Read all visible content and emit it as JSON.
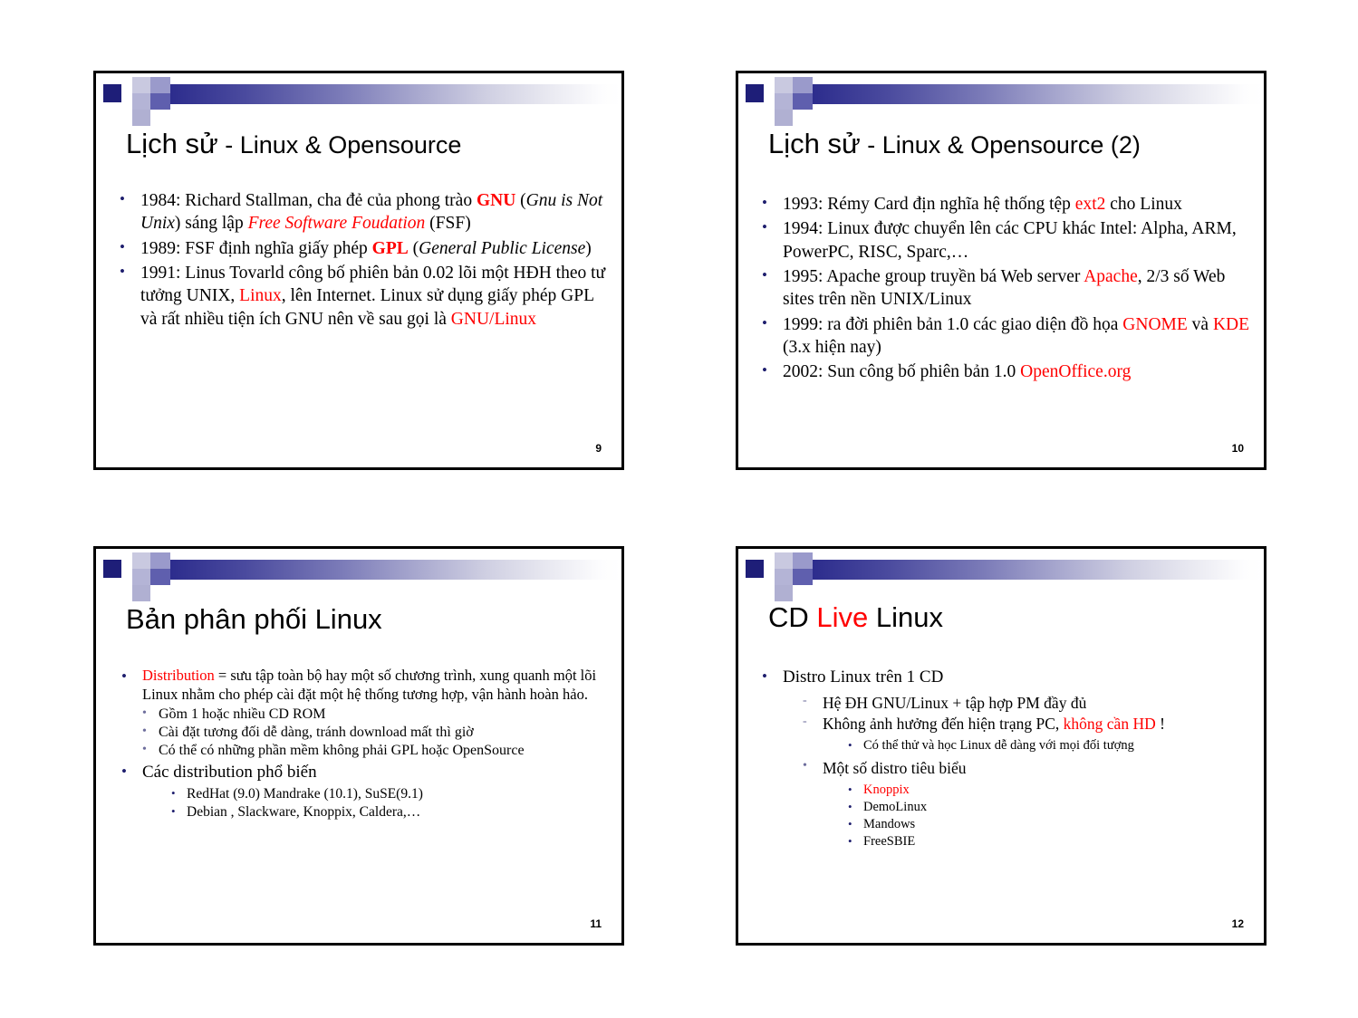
{
  "document": {
    "type": "presentation-handout",
    "slides_per_page": 4,
    "colors": {
      "accent_red": "#ff0000",
      "bullet_navy": "#1f1f6e",
      "band_dark": "#1e1e78",
      "frame_border": "#000000",
      "background": "#ffffff"
    }
  },
  "slides": [
    {
      "page_number": "9",
      "title": {
        "main": "Lịch sử",
        "separator": " - ",
        "rest": "Linux & Opensource"
      },
      "bullets": [
        {
          "level": 1,
          "runs": [
            {
              "text": "1984: Richard Stallman, cha đẻ của phong trào ",
              "style": "plain"
            },
            {
              "text": "GNU",
              "style": "bold-red"
            },
            {
              "text": " (",
              "style": "plain"
            },
            {
              "text": "Gnu is Not Unix",
              "style": "italic"
            },
            {
              "text": ") sáng lập ",
              "style": "plain"
            },
            {
              "text": "Free Software Foudation",
              "style": "italic-red"
            },
            {
              "text": " (FSF)",
              "style": "plain"
            }
          ]
        },
        {
          "level": 1,
          "runs": [
            {
              "text": "1989: FSF định nghĩa giấy phép ",
              "style": "plain"
            },
            {
              "text": "GPL",
              "style": "bold-red"
            },
            {
              "text": " (",
              "style": "plain"
            },
            {
              "text": "General Public License",
              "style": "italic"
            },
            {
              "text": ")",
              "style": "plain"
            }
          ]
        },
        {
          "level": 1,
          "runs": [
            {
              "text": "1991: Linus Tovarld công bố phiên bản 0.02 lõi một HĐH theo tư tưởng UNIX, ",
              "style": "plain"
            },
            {
              "text": "Linux",
              "style": "red"
            },
            {
              "text": ", lên Internet. Linux sử dụng giấy phép GPL và rất nhiều tiện ích GNU nên về sau gọi là ",
              "style": "plain"
            },
            {
              "text": "GNU/Linux",
              "style": "red"
            }
          ]
        }
      ]
    },
    {
      "page_number": "10",
      "title": {
        "main": "Lịch sử",
        "separator": " - ",
        "rest": "Linux & Opensource (2)"
      },
      "bullets": [
        {
          "level": 1,
          "runs": [
            {
              "text": "1993: Rémy Card địn nghĩa hệ thống tệp ",
              "style": "plain"
            },
            {
              "text": "ext2",
              "style": "red"
            },
            {
              "text": " cho Linux",
              "style": "plain"
            }
          ]
        },
        {
          "level": 1,
          "runs": [
            {
              "text": "1994: Linux được chuyển lên các CPU khác Intel: Alpha, ARM, PowerPC, RISC, Sparc,…",
              "style": "plain"
            }
          ]
        },
        {
          "level": 1,
          "runs": [
            {
              "text": "1995: Apache group truyền bá Web server ",
              "style": "plain"
            },
            {
              "text": "Apache",
              "style": "red"
            },
            {
              "text": ", 2/3 số Web sites trên nền UNIX/Linux",
              "style": "plain"
            }
          ]
        },
        {
          "level": 1,
          "runs": [
            {
              "text": "1999: ra đời phiên bản 1.0 các giao diện đồ họa ",
              "style": "plain"
            },
            {
              "text": "GNOME",
              "style": "red"
            },
            {
              "text": " và ",
              "style": "plain"
            },
            {
              "text": "KDE",
              "style": "red"
            },
            {
              "text": " (3.x hiện nay)",
              "style": "plain"
            }
          ]
        },
        {
          "level": 1,
          "runs": [
            {
              "text": "2002: Sun công bố phiên bản 1.0 ",
              "style": "plain"
            },
            {
              "text": "OpenOffice.org",
              "style": "red"
            }
          ]
        }
      ]
    },
    {
      "page_number": "11",
      "title": {
        "main": "Bản phân phối Linux",
        "separator": "",
        "rest": ""
      },
      "bullets": [
        {
          "level": 1,
          "runs": [
            {
              "text": "Distribution",
              "style": "red"
            },
            {
              "text": " = sưu tập toàn bộ hay một số chương trình, xung quanh một lõi Linux nhằm cho phép cài đặt một hệ thống tương hợp, vận hành hoàn hảo.",
              "style": "plain"
            }
          ]
        },
        {
          "level": 2,
          "runs": [
            {
              "text": "Gồm 1 hoặc nhiều CD ROM",
              "style": "plain"
            }
          ]
        },
        {
          "level": 2,
          "runs": [
            {
              "text": "Cài đặt tương đối dễ dàng, tránh download mất thì giờ",
              "style": "plain"
            }
          ]
        },
        {
          "level": 2,
          "runs": [
            {
              "text": "Có thể có những phần mềm không phải GPL hoặc OpenSource",
              "style": "plain"
            }
          ]
        },
        {
          "level": 1,
          "runs": [
            {
              "text": "Các distribution phổ biến",
              "style": "plain"
            }
          ]
        },
        {
          "level": 3,
          "runs": [
            {
              "text": "RedHat (9.0) Mandrake (10.1), SuSE(9.1)",
              "style": "plain"
            }
          ]
        },
        {
          "level": 3,
          "runs": [
            {
              "text": "Debian , Slackware, Knoppix, Caldera,…",
              "style": "plain"
            }
          ]
        }
      ]
    },
    {
      "page_number": "12",
      "title": {
        "main": "CD ",
        "separator": "Live",
        "rest": " Linux",
        "separator_red": true
      },
      "bullets": [
        {
          "level": 1,
          "runs": [
            {
              "text": "Distro Linux trên 1 CD",
              "style": "plain"
            }
          ]
        },
        {
          "level": 2,
          "marker": "dash",
          "runs": [
            {
              "text": "Hệ ĐH GNU/Linux + tập hợp PM đầy đủ",
              "style": "plain"
            }
          ]
        },
        {
          "level": 2,
          "marker": "dash",
          "runs": [
            {
              "text": "Không ảnh hưởng đến hiện trạng PC, ",
              "style": "plain"
            },
            {
              "text": "không cần HD",
              "style": "red"
            },
            {
              "text": " !",
              "style": "plain"
            }
          ]
        },
        {
          "level": 3,
          "runs": [
            {
              "text": "Có thể thử và học Linux dễ dàng với mọi đối tượng",
              "style": "plain"
            }
          ]
        },
        {
          "level": 2,
          "marker": "bullet",
          "runs": [
            {
              "text": "Một số distro tiêu biểu",
              "style": "plain"
            }
          ]
        },
        {
          "level": 3,
          "runs": [
            {
              "text": "Knoppix",
              "style": "red"
            }
          ]
        },
        {
          "level": 3,
          "runs": [
            {
              "text": "DemoLinux",
              "style": "plain"
            }
          ]
        },
        {
          "level": 3,
          "runs": [
            {
              "text": "Mandows",
              "style": "plain"
            }
          ]
        },
        {
          "level": 3,
          "runs": [
            {
              "text": "FreeSBIE",
              "style": "plain"
            }
          ]
        }
      ]
    }
  ],
  "markers": {
    "bullet": "•",
    "dash": "-",
    "small_bullet": "•"
  }
}
